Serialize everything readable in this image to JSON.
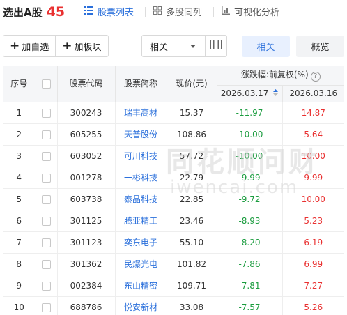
{
  "header": {
    "title": "选出A股",
    "count": "45",
    "tabs": [
      {
        "label": "股票列表",
        "icon": "list-icon",
        "active": true
      },
      {
        "label": "多股同列",
        "icon": "grid-icon",
        "active": false
      },
      {
        "label": "可视化分析",
        "icon": "bar-chart-icon",
        "active": false
      }
    ]
  },
  "toolbar": {
    "add_watchlist": "加自选",
    "add_sector": "加板块",
    "sort_select": "相关",
    "view_related": "相关",
    "view_overview": "概览"
  },
  "table": {
    "headers": {
      "index": "序号",
      "code": "股票代码",
      "name": "股票简称",
      "price": "现价(元)",
      "change_group": "涨跌幅:前复权(%)",
      "date1": "2026.03.17",
      "date2": "2026.03.16"
    },
    "rows": [
      {
        "index": "1",
        "code": "300243",
        "name": "瑞丰高材",
        "price": "15.37",
        "chg1": "-11.97",
        "chg2": "14.87"
      },
      {
        "index": "2",
        "code": "605255",
        "name": "天普股份",
        "price": "108.86",
        "chg1": "-10.00",
        "chg2": "5.64"
      },
      {
        "index": "3",
        "code": "603052",
        "name": "可川科技",
        "price": "57.72",
        "chg1": "-10.00",
        "chg2": "10.00"
      },
      {
        "index": "4",
        "code": "001278",
        "name": "一彬科技",
        "price": "22.79",
        "chg1": "-9.99",
        "chg2": "9.99"
      },
      {
        "index": "5",
        "code": "603738",
        "name": "泰晶科技",
        "price": "22.85",
        "chg1": "-9.72",
        "chg2": "10.00"
      },
      {
        "index": "6",
        "code": "301125",
        "name": "腾亚精工",
        "price": "23.46",
        "chg1": "-8.93",
        "chg2": "5.23"
      },
      {
        "index": "7",
        "code": "301123",
        "name": "奕东电子",
        "price": "55.10",
        "chg1": "-8.20",
        "chg2": "6.19"
      },
      {
        "index": "8",
        "code": "301362",
        "name": "民爆光电",
        "price": "101.82",
        "chg1": "-7.86",
        "chg2": "6.99"
      },
      {
        "index": "9",
        "code": "002384",
        "name": "东山精密",
        "price": "109.71",
        "chg1": "-7.81",
        "chg2": "7.27"
      },
      {
        "index": "10",
        "code": "688786",
        "name": "悦安新材",
        "price": "33.08",
        "chg1": "-7.57",
        "chg2": "5.26"
      }
    ]
  },
  "watermark": {
    "line1": "同花顺问财",
    "line2": "iwencai.com"
  },
  "colors": {
    "accent": "#2a6fdb",
    "up": "#e93030",
    "down": "#1a9c3e",
    "header_bg": "#f5f6f8"
  }
}
